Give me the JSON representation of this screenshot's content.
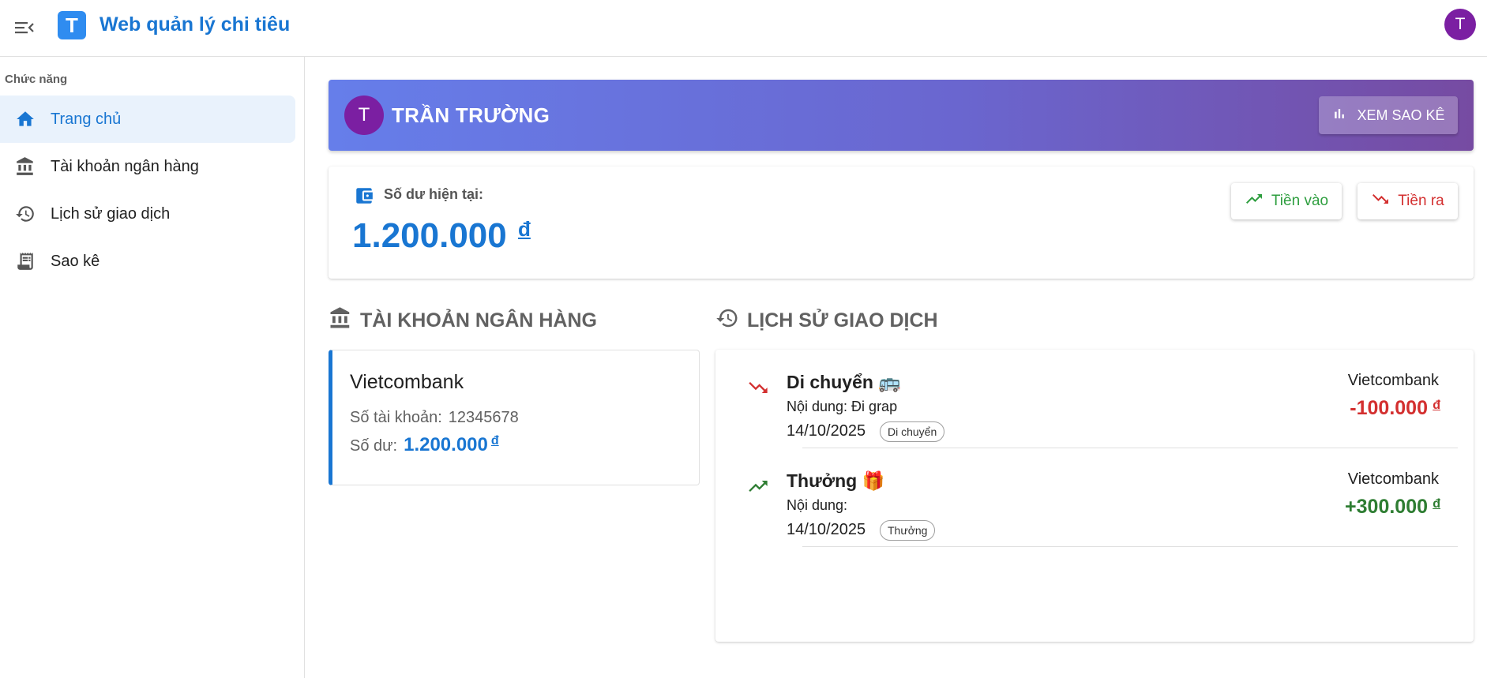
{
  "app": {
    "title": "Web quản lý chi tiêu",
    "logo_letter": "T",
    "user_initial": "T"
  },
  "sidebar": {
    "heading": "Chức năng",
    "items": [
      {
        "label": "Trang chủ",
        "icon": "home-icon",
        "active": true
      },
      {
        "label": "Tài khoản ngân hàng",
        "icon": "bank-icon",
        "active": false
      },
      {
        "label": "Lịch sử giao dịch",
        "icon": "history-icon",
        "active": false
      },
      {
        "label": "Sao kê",
        "icon": "receipt-icon",
        "active": false
      }
    ]
  },
  "hero": {
    "avatar_initial": "T",
    "name": "TRẦN TRƯỜNG",
    "statement_button": "XEM SAO KÊ"
  },
  "balance": {
    "label": "Số dư hiện tại:",
    "amount": "1.200.000",
    "currency": "đ",
    "in_button": "Tiền vào",
    "out_button": "Tiền ra"
  },
  "banks_section": {
    "title": "TÀI KHOẢN NGÂN HÀNG",
    "accounts": [
      {
        "name": "Vietcombank",
        "account_label": "Số tài khoản:",
        "account_number": "12345678",
        "balance_label": "Số dư:",
        "balance": "1.200.000",
        "currency": "đ"
      }
    ]
  },
  "transactions_section": {
    "title": "LỊCH SỬ GIAO DỊCH",
    "items": [
      {
        "type": "out",
        "title": "Di chuyển 🚌",
        "description": "Nội dung: Đi grap",
        "date": "14/10/2025",
        "category": "Di chuyển",
        "bank": "Vietcombank",
        "amount": "-100.000",
        "currency": "đ"
      },
      {
        "type": "in",
        "title": "Thưởng 🎁",
        "description": "Nội dung:",
        "date": "14/10/2025",
        "category": "Thưởng",
        "bank": "Vietcombank",
        "amount": "+300.000",
        "currency": "đ"
      }
    ]
  },
  "colors": {
    "primary": "#1976d2",
    "income": "#2e7d32",
    "expense": "#d32f2f",
    "avatar": "#7b1fa2",
    "hero_start": "#667eea",
    "hero_end": "#764ba2"
  }
}
